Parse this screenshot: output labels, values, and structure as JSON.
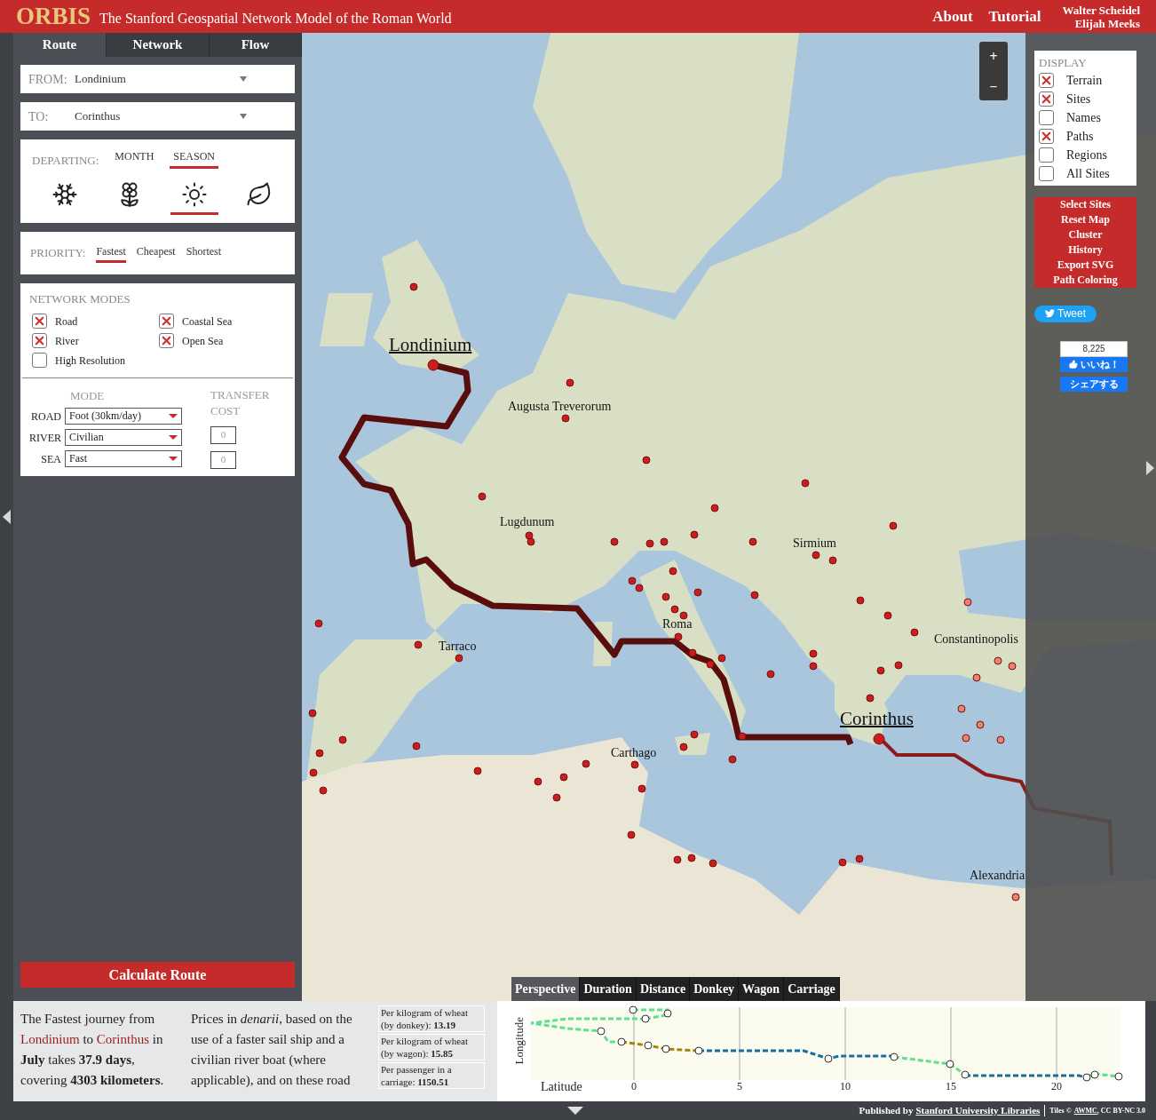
{
  "header": {
    "logo": "ORBIS",
    "subtitle": "The Stanford Geospatial Network Model of the Roman World",
    "links": [
      {
        "label": "About"
      },
      {
        "label": "Tutorial"
      }
    ],
    "authors": [
      "Walter Scheidel",
      "Elijah Meeks"
    ]
  },
  "left_tabs": [
    {
      "label": "Route",
      "selected": true
    },
    {
      "label": "Network",
      "selected": false
    },
    {
      "label": "Flow",
      "selected": false
    }
  ],
  "from": {
    "label": "FROM:",
    "value": "Londinium"
  },
  "to": {
    "label": "TO:",
    "value": "Corinthus"
  },
  "departing": {
    "label": "DEPARTING:",
    "options": [
      {
        "label": "MONTH",
        "selected": false
      },
      {
        "label": "SEASON",
        "selected": true
      }
    ],
    "seasons": [
      {
        "kind": "winter",
        "selected": false
      },
      {
        "kind": "spring",
        "selected": false
      },
      {
        "kind": "summer",
        "selected": true
      },
      {
        "kind": "autumn",
        "selected": false
      }
    ]
  },
  "priority": {
    "label": "PRIORITY:",
    "options": [
      {
        "label": "Fastest",
        "selected": true
      },
      {
        "label": "Cheapest",
        "selected": false
      },
      {
        "label": "Shortest",
        "selected": false
      }
    ]
  },
  "network_modes": {
    "title": "NETWORK MODES",
    "items": [
      {
        "label": "Road",
        "checked": true
      },
      {
        "label": "Coastal Sea",
        "checked": true
      },
      {
        "label": "River",
        "checked": true
      },
      {
        "label": "Open Sea",
        "checked": true
      },
      {
        "label": "High Resolution",
        "checked": false
      }
    ]
  },
  "mode_table": {
    "mode_heading": "MODE",
    "transfer_heading": "TRANSFER COST",
    "rows": [
      {
        "label": "ROAD",
        "value": "Foot (30km/day)"
      },
      {
        "label": "RIVER",
        "value": "Civilian",
        "transfer": "0"
      },
      {
        "label": "SEA",
        "value": "Fast",
        "transfer": "0"
      }
    ]
  },
  "calculate_button": "Calculate Route",
  "map": {
    "zoom_in": "+",
    "zoom_out": "–",
    "labels": [
      {
        "text": "Londinium",
        "kind": "endpoint"
      },
      {
        "text": "Augusta Treverorum",
        "kind": "site"
      },
      {
        "text": "Lugdunum",
        "kind": "site"
      },
      {
        "text": "Sirmium",
        "kind": "site"
      },
      {
        "text": "Roma",
        "kind": "site"
      },
      {
        "text": "Tarraco",
        "kind": "site"
      },
      {
        "text": "Constantinopolis",
        "kind": "site"
      },
      {
        "text": "Carthago",
        "kind": "site"
      },
      {
        "text": "Corinthus",
        "kind": "endpoint"
      },
      {
        "text": "Alexandria",
        "kind": "site"
      }
    ]
  },
  "display": {
    "title": "DISPLAY",
    "items": [
      {
        "label": "Terrain",
        "checked": true
      },
      {
        "label": "Sites",
        "checked": true
      },
      {
        "label": "Names",
        "checked": false
      },
      {
        "label": "Paths",
        "checked": true
      },
      {
        "label": "Regions",
        "checked": false
      },
      {
        "label": "All Sites",
        "checked": false
      }
    ]
  },
  "actions": [
    "Select Sites",
    "Reset Map",
    "Cluster",
    "History",
    "Export SVG",
    "Path Coloring"
  ],
  "social": {
    "tweet": "Tweet",
    "like_count": "8,225",
    "like": "いいね！",
    "share": "シェアする"
  },
  "summary": {
    "segments": [
      {
        "text": "The Fastest journey from ",
        "kind": "plain"
      },
      {
        "text": "Londinium",
        "kind": "place"
      },
      {
        "text": " to ",
        "kind": "plain"
      },
      {
        "text": "Corinthus",
        "kind": "place"
      },
      {
        "text": " in ",
        "kind": "plain"
      },
      {
        "text": "July",
        "kind": "bold"
      },
      {
        "text": " takes ",
        "kind": "plain"
      },
      {
        "text": "37.9 days",
        "kind": "bold"
      },
      {
        "text": ", covering ",
        "kind": "plain"
      },
      {
        "text": "4303 kilometers",
        "kind": "bold"
      },
      {
        "text": ".",
        "kind": "plain"
      }
    ],
    "prices_text": "Prices in *denarii*, based on the use of a faster sail ship and a civilian river boat (where applicable), and on these road",
    "prices": [
      "Per kilogram of wheat (by donkey): **13.19**",
      "Per kilogram of wheat (by wagon): **15.85**",
      "Per passenger in a carriage: **1150.51**"
    ]
  },
  "chart": {
    "tabs": [
      {
        "label": "Perspective",
        "selected": true
      },
      {
        "label": "Duration",
        "selected": false
      },
      {
        "label": "Distance",
        "selected": false
      },
      {
        "label": "Donkey",
        "selected": false
      },
      {
        "label": "Wagon",
        "selected": false
      },
      {
        "label": "Carriage",
        "selected": false
      }
    ],
    "ylabel": "Longitude",
    "xlabel": "Latitude",
    "x_tick_labels": [
      "0",
      "5",
      "10",
      "15",
      "20"
    ]
  },
  "footer": {
    "published_by": "Published by",
    "publisher": "Stanford University Libraries",
    "tiles": "Tiles ©",
    "tiles_link": "AWMC",
    "license": ", CC BY-NC 3.0"
  }
}
